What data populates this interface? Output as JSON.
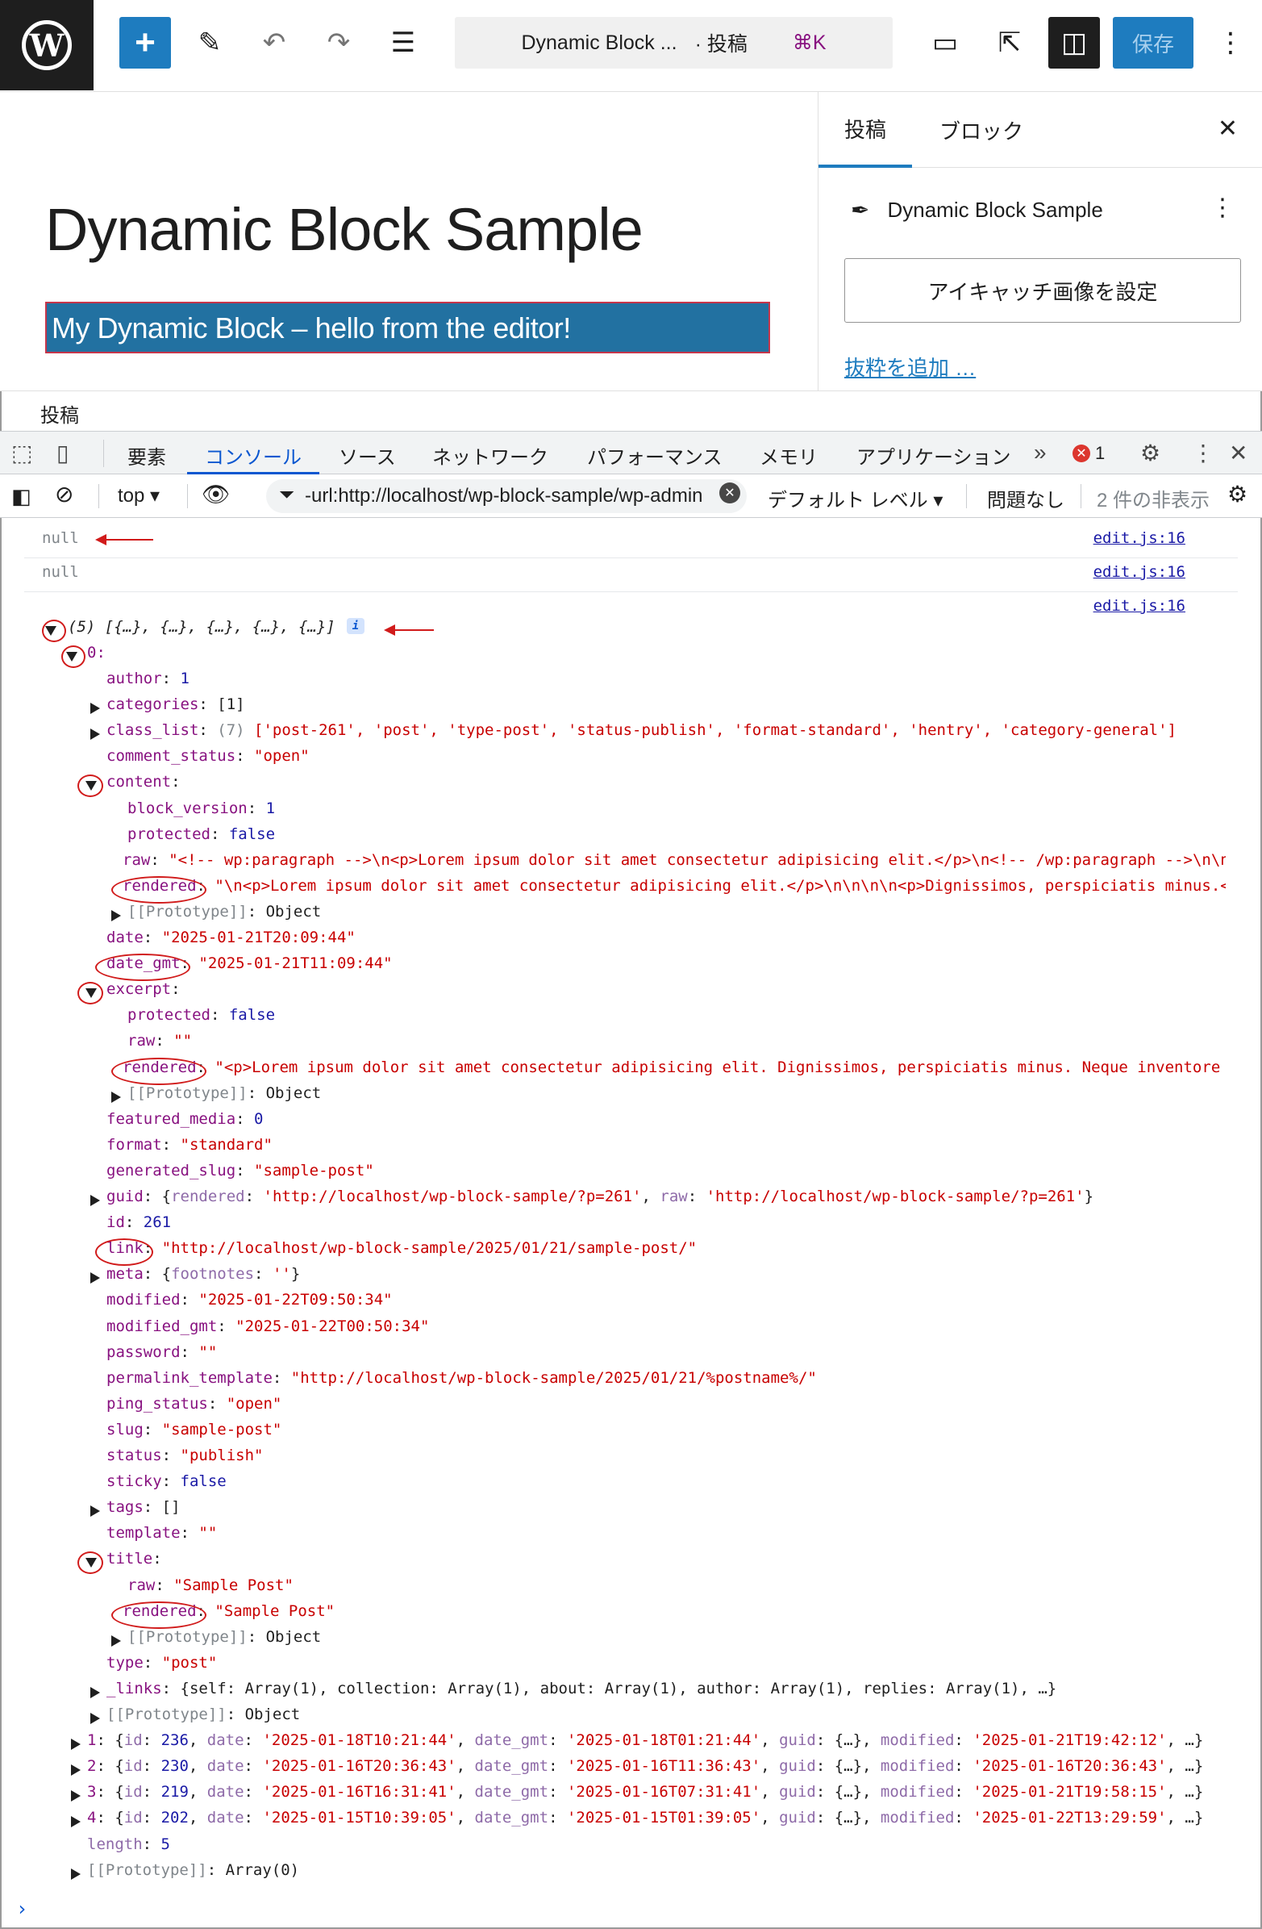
{
  "toolbar": {
    "logo_letter": "W",
    "add_icon": "plus-icon",
    "doc_title": "Dynamic Block ...",
    "doc_type": "· 投稿",
    "shortcut": "⌘K",
    "save_label": "保存"
  },
  "editor": {
    "post_title": "Dynamic Block Sample",
    "block_text": "My Dynamic Block – hello from the editor!"
  },
  "sidebar": {
    "tab_post": "投稿",
    "tab_block": "ブロック",
    "post_name": "Dynamic Block Sample",
    "featured_button": "アイキャッチ画像を設定",
    "excerpt_link": "抜粋を追加 …"
  },
  "breadcrumb": "投稿",
  "devtools": {
    "tabs": [
      "要素",
      "コンソール",
      "ソース",
      "ネットワーク",
      "パフォーマンス",
      "メモリ",
      "アプリケーション"
    ],
    "error_count": "1",
    "context": "top",
    "filter_value": "-url:http://localhost/wp-block-sample/wp-admin",
    "level": "デフォルト レベル",
    "issues": "問題なし",
    "hidden": "2 件の非表示"
  },
  "console": {
    "source_link": "edit.js:16",
    "null_text": "null",
    "array_summary": "(5) [{…}, {…}, {…}, {…}, {…}]",
    "item0": {
      "index": "0",
      "author": "1",
      "categories": "[1]",
      "class_list_count": "(7)",
      "class_list": "['post-261', 'post', 'type-post', 'status-publish', 'format-standard', 'hentry', 'category-general']",
      "comment_status": "\"open\"",
      "block_version": "1",
      "content_protected": "false",
      "content_raw": "\"<!-- wp:paragraph -->\\n<p>Lorem ipsum dolor sit amet consectetur adipisicing elit.</p>\\n<!-- /wp:paragraph -->\\n\\n<!--",
      "content_rendered": "\"\\n<p>Lorem ipsum dolor sit amet consectetur adipisicing elit.</p>\\n\\n\\n\\n<p>Dignissimos, perspiciatis minus.</p>\\",
      "date": "\"2025-01-21T20:09:44\"",
      "date_gmt": "\"2025-01-21T11:09:44\"",
      "excerpt_protected": "false",
      "excerpt_raw": "\"\"",
      "excerpt_rendered": "\"<p>Lorem ipsum dolor sit amet consectetur adipisicing elit. Dignissimos, perspiciatis minus. Neque inventore accu",
      "featured_media": "0",
      "format": "\"standard\"",
      "generated_slug": "\"sample-post\"",
      "guid_rendered": "'http://localhost/wp-block-sample/?p=261'",
      "guid_raw": "'http://localhost/wp-block-sample/?p=261'",
      "id": "261",
      "link": "\"http://localhost/wp-block-sample/2025/01/21/sample-post/\"",
      "meta_footnotes": "''",
      "modified": "\"2025-01-22T09:50:34\"",
      "modified_gmt": "\"2025-01-22T00:50:34\"",
      "password": "\"\"",
      "permalink_template": "\"http://localhost/wp-block-sample/2025/01/21/%postname%/\"",
      "ping_status": "\"open\"",
      "slug": "\"sample-post\"",
      "status": "\"publish\"",
      "sticky": "false",
      "tags": "[]",
      "template": "\"\"",
      "title_raw": "\"Sample Post\"",
      "title_rendered": "\"Sample Post\"",
      "type": "\"post\"",
      "links": "{self: Array(1), collection: Array(1), about: Array(1), author: Array(1), replies: Array(1), …}"
    },
    "others": [
      {
        "idx": "1",
        "id": "236",
        "date": "'2025-01-18T10:21:44'",
        "date_gmt": "'2025-01-18T01:21:44'",
        "modified": "'2025-01-21T19:42:12'"
      },
      {
        "idx": "2",
        "id": "230",
        "date": "'2025-01-16T20:36:43'",
        "date_gmt": "'2025-01-16T11:36:43'",
        "modified": "'2025-01-16T20:36:43'"
      },
      {
        "idx": "3",
        "id": "219",
        "date": "'2025-01-16T16:31:41'",
        "date_gmt": "'2025-01-16T07:31:41'",
        "modified": "'2025-01-21T19:58:15'"
      },
      {
        "idx": "4",
        "id": "202",
        "date": "'2025-01-15T10:39:05'",
        "date_gmt": "'2025-01-15T01:39:05'",
        "modified": "'2025-01-22T13:29:59'"
      }
    ],
    "length": "5",
    "proto_object": "Object",
    "proto_array": "Array(0)"
  }
}
